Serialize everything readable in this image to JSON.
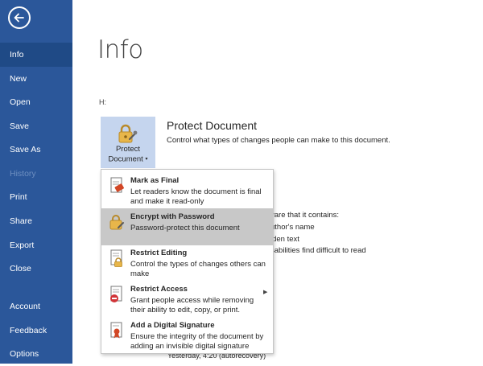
{
  "sidebar": {
    "items": [
      {
        "label": "Info"
      },
      {
        "label": "New"
      },
      {
        "label": "Open"
      },
      {
        "label": "Save"
      },
      {
        "label": "Save As"
      },
      {
        "label": "History"
      },
      {
        "label": "Print"
      },
      {
        "label": "Share"
      },
      {
        "label": "Export"
      },
      {
        "label": "Close"
      },
      {
        "label": "Account"
      },
      {
        "label": "Feedback"
      },
      {
        "label": "Options"
      }
    ]
  },
  "main": {
    "title": "Info",
    "path": "H:",
    "protect": {
      "tile_line1": "Protect",
      "tile_line2": "Document",
      "caret": "▾",
      "heading": "Protect Document",
      "description": "Control what types of changes people can make to this document."
    },
    "background_lines": [
      "vare that it contains:",
      "uthor's name",
      "lden text",
      "sabilities find difficult to read",
      "Yesterday, 4:20 (autorecovery)"
    ]
  },
  "dropdown": {
    "items": [
      {
        "title": "Mark as Final",
        "desc": "Let readers know the document is final and make it read-only",
        "icon": "mark-final-icon"
      },
      {
        "title": "Encrypt with Password",
        "desc": "Password-protect this document",
        "icon": "encrypt-lock-icon"
      },
      {
        "title": "Restrict Editing",
        "desc": "Control the types of changes others can make",
        "icon": "restrict-editing-icon"
      },
      {
        "title": "Restrict Access",
        "desc": "Grant people access while removing their ability to edit, copy, or print.",
        "icon": "restrict-access-icon",
        "submenu_arrow": "▶"
      },
      {
        "title": "Add a Digital Signature",
        "desc": "Ensure the integrity of the document by adding an invisible digital signature",
        "icon": "digital-signature-icon"
      }
    ]
  },
  "colors": {
    "sidebar_bg": "#2b579a",
    "sidebar_active": "#1f4a86",
    "tile_bg": "#c5d5ee",
    "selected_item": "#c8c8c8",
    "lock_gold": "#e8b64a"
  }
}
